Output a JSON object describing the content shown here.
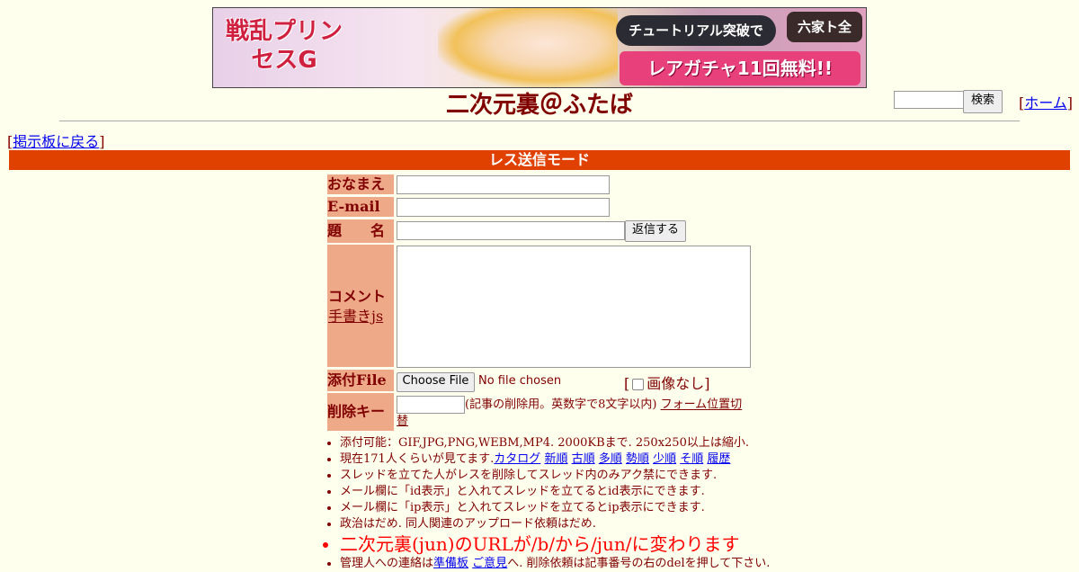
{
  "banner": {
    "logo_text": "戦乱プリンセスG",
    "tutorial_text": "チュートリアル突破で",
    "rokuzen_text": "六家ト全",
    "gacha_text": "レアガチャ11回無料!!"
  },
  "header": {
    "title": "二次元裏＠ふたば",
    "search_button": "検索",
    "home_link": "ホーム",
    "back_link": "掲示板に戻る"
  },
  "mode_bar": "レス送信モード",
  "form": {
    "name_label": "おなまえ",
    "email_label": "E-mail",
    "subject_label": "題　　名",
    "reply_button": "返信する",
    "comment_label": "コメント",
    "handwrite_link": "手書きjs",
    "file_label": "添付File",
    "choose_file": "Choose File",
    "no_file": "No file chosen",
    "no_image": "画像なし",
    "delkey_label": "削除キー",
    "delkey_note": "(記事の削除用。英数字で8文字以内)",
    "form_position_link": "フォーム位置切替"
  },
  "notes": {
    "line1": "添付可能：GIF,JPG,PNG,WEBM,MP4. 2000KBまで. 250x250以上は縮小.",
    "line2_prefix": "現在171人くらいが見てます.",
    "links": [
      "カタログ",
      "新順",
      "古順",
      "多順",
      "勢順",
      "少順",
      "そ順",
      "履歴"
    ],
    "line3": "スレッドを立てた人がレスを削除してスレッド内のみアク禁にできます.",
    "line4": "メール欄に「id表示」と入れてスレッドを立てるとid表示にできます.",
    "line5": "メール欄に「ip表示」と入れてスレッドを立てるとip表示にできます.",
    "line6": "政治はだめ. 同人関連のアップロード依頼はだめ.",
    "line7": "二次元裏(jun)のURLが/b/から/jun/に変わります",
    "line8_prefix": "管理人への連絡は",
    "line8_link1": "準備板",
    "line8_link2": "ご意見",
    "line8_suffix": "へ. 削除依頼は記事番号の右のdelを押して下さい."
  }
}
